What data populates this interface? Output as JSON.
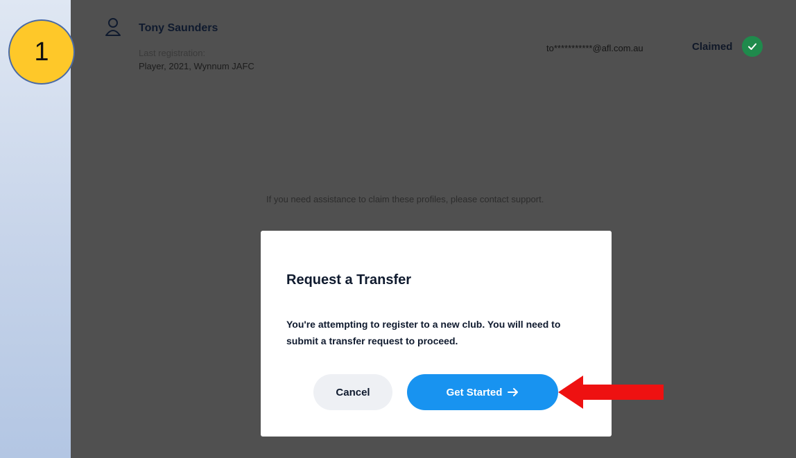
{
  "step": {
    "number": "1"
  },
  "profile": {
    "name": "Tony Saunders",
    "last_registration_label": "Last registration:",
    "last_registration_value": "Player, 2021, Wynnum JAFC",
    "email": "to***********@afl.com.au",
    "status": "Claimed"
  },
  "support_text": "If you need assistance to claim these profiles, please contact support.",
  "modal": {
    "title": "Request a Transfer",
    "body": "You're attempting to register to a new club. You will need to submit a transfer request to proceed.",
    "cancel_label": "Cancel",
    "start_label": "Get Started"
  },
  "icons": {
    "profile": "user-icon",
    "claimed": "check-circle-icon",
    "start_arrow": "arrow-right-icon",
    "callout": "red-arrow-left-icon"
  },
  "colors": {
    "badge": "#fec829",
    "primary_button": "#1893f0",
    "claimed_check": "#1f8a4c",
    "callout_arrow": "#ee1111",
    "overlay": "#505050"
  }
}
